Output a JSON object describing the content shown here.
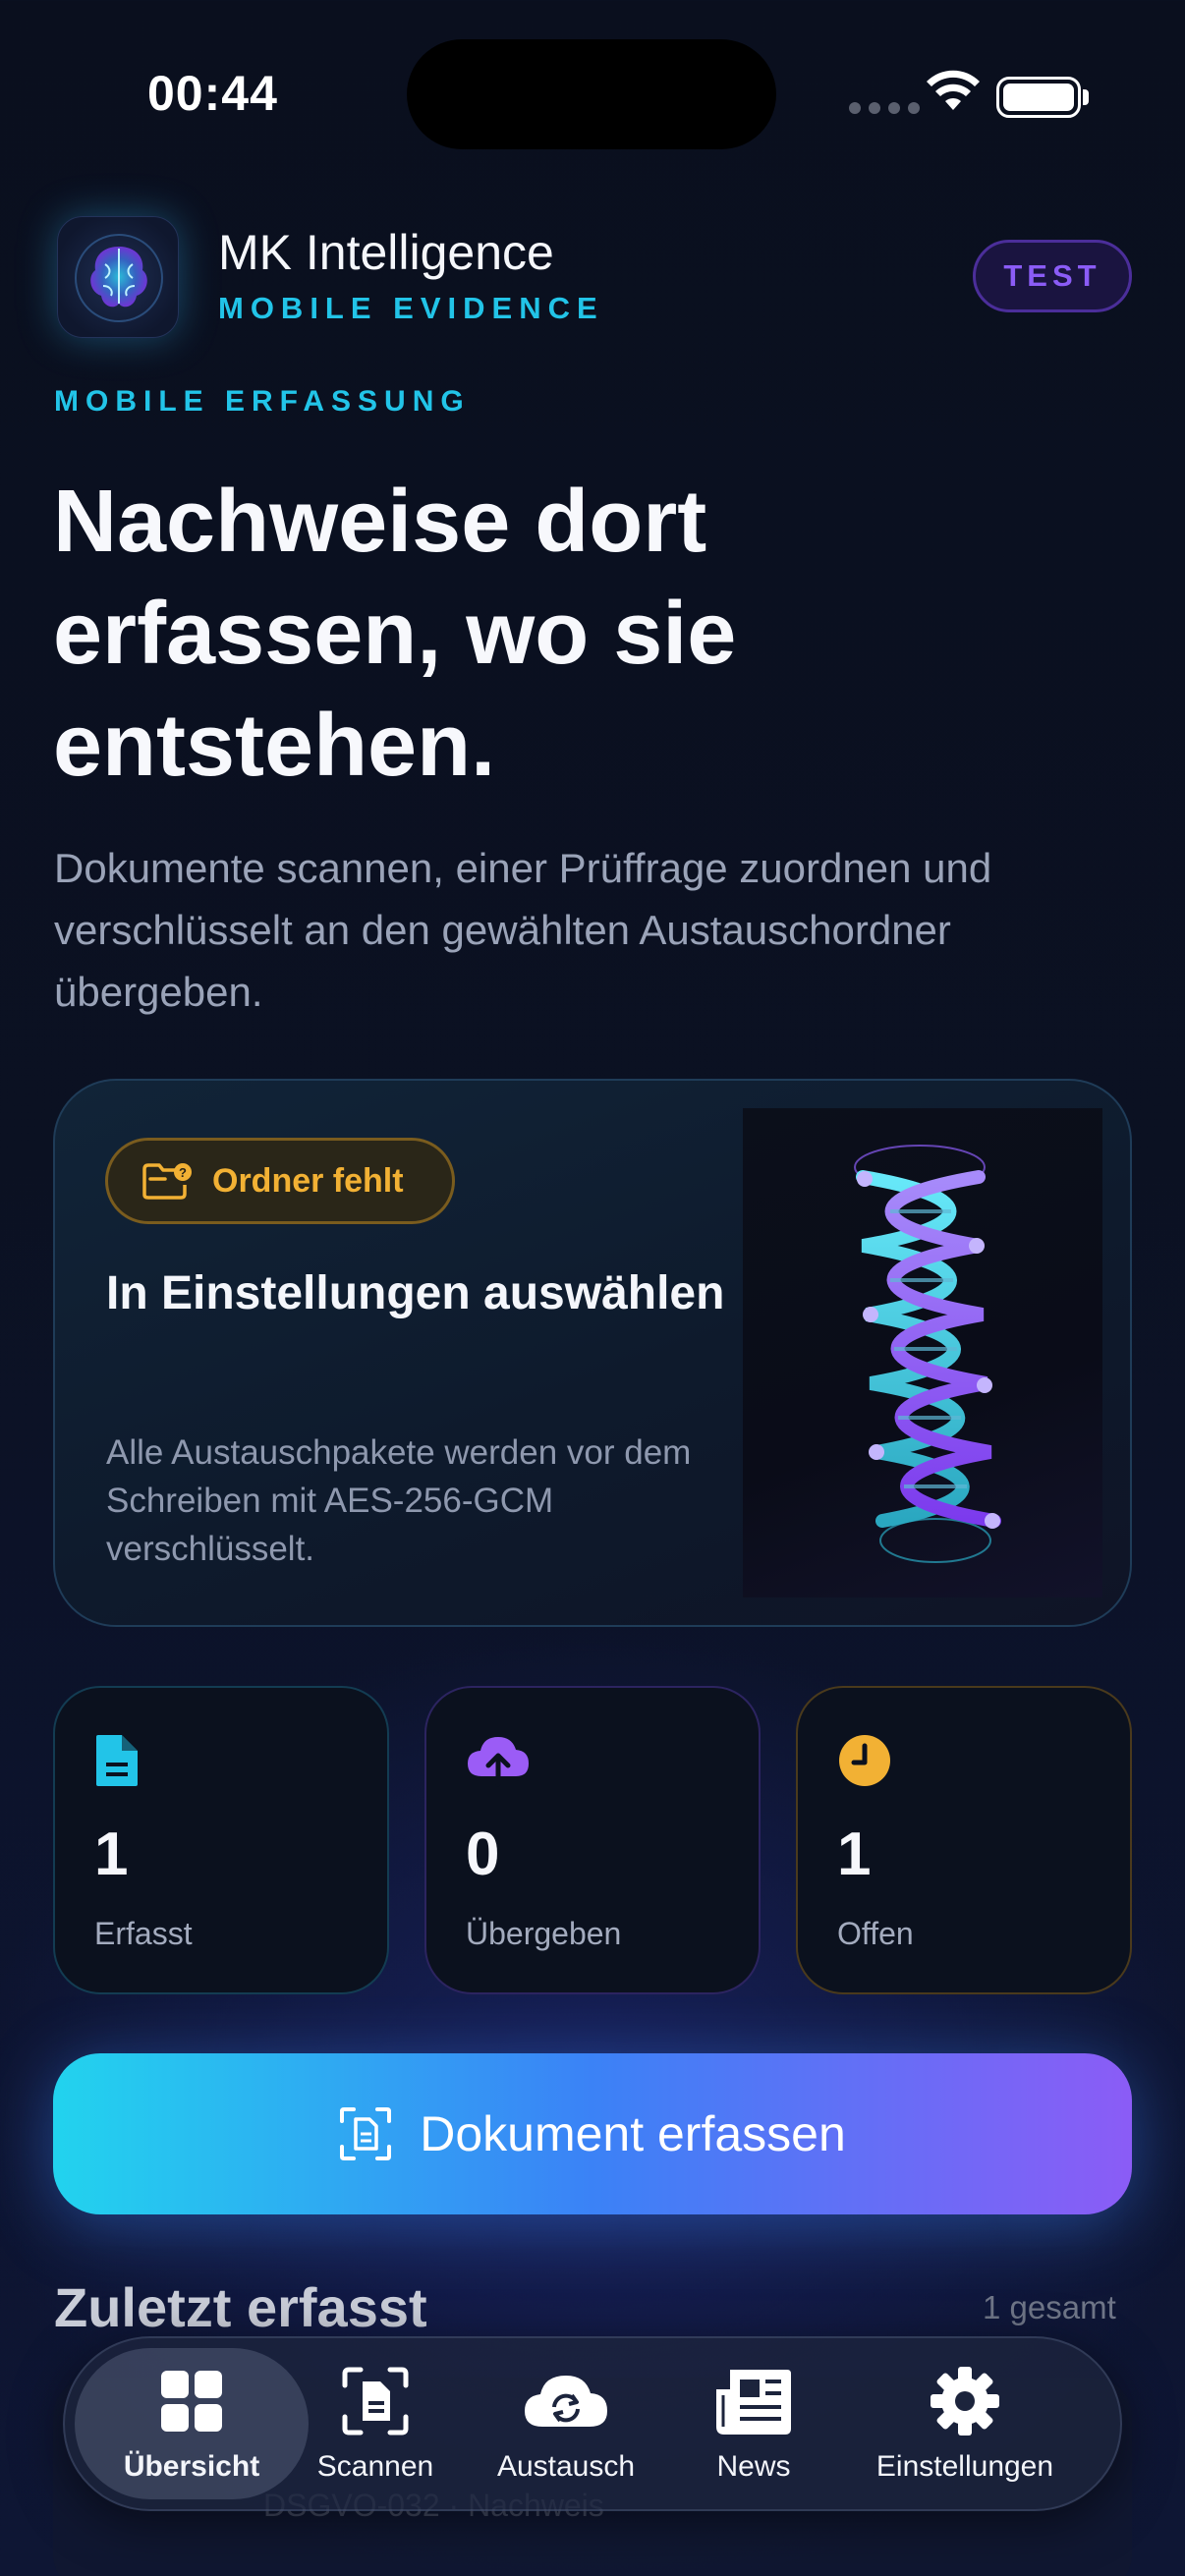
{
  "status_bar": {
    "time": "00:44"
  },
  "brand": {
    "title": "MK Intelligence",
    "subtitle": "MOBILE EVIDENCE",
    "env_badge": "TEST"
  },
  "hero": {
    "eyebrow": "MOBILE ERFASSUNG",
    "headline": "Nachweise dort erfassen, wo sie entstehen.",
    "lead": "Dokumente scannen, einer Prüffrage zuordnen und verschlüsselt an den gewählten Austauschordner übergeben."
  },
  "folder_card": {
    "chip": "Ordner fehlt",
    "title": "In Einstellungen auswählen",
    "text": "Alle Austauschpakete werden vor dem Schreiben mit AES-256-GCM verschlüsselt."
  },
  "stats": [
    {
      "value": "1",
      "label": "Erfasst",
      "icon": "document-icon",
      "color": "#22C4E8"
    },
    {
      "value": "0",
      "label": "Übergeben",
      "icon": "cloud-upload-icon",
      "color": "#9B5CF6"
    },
    {
      "value": "1",
      "label": "Offen",
      "icon": "clock-icon",
      "color": "#F2B134"
    }
  ],
  "cta": {
    "label": "Dokument erfassen"
  },
  "recent": {
    "title": "Zuletzt erfasst",
    "count": "1 gesamt",
    "items": [
      {
        "subtitle": "DSGVO-032 · Nachweis"
      }
    ]
  },
  "tabbar": {
    "items": [
      {
        "label": "Übersicht",
        "icon": "grid-icon",
        "active": true
      },
      {
        "label": "Scannen",
        "icon": "scan-document-icon",
        "active": false
      },
      {
        "label": "Austausch",
        "icon": "cloud-sync-icon",
        "active": false
      },
      {
        "label": "News",
        "icon": "newspaper-icon",
        "active": false
      },
      {
        "label": "Einstellungen",
        "icon": "gear-icon",
        "active": false
      }
    ]
  },
  "colors": {
    "accent_cyan": "#22C4E8",
    "accent_violet": "#8B5CF6",
    "warning": "#F2B134",
    "background": "#0A0F1E"
  }
}
